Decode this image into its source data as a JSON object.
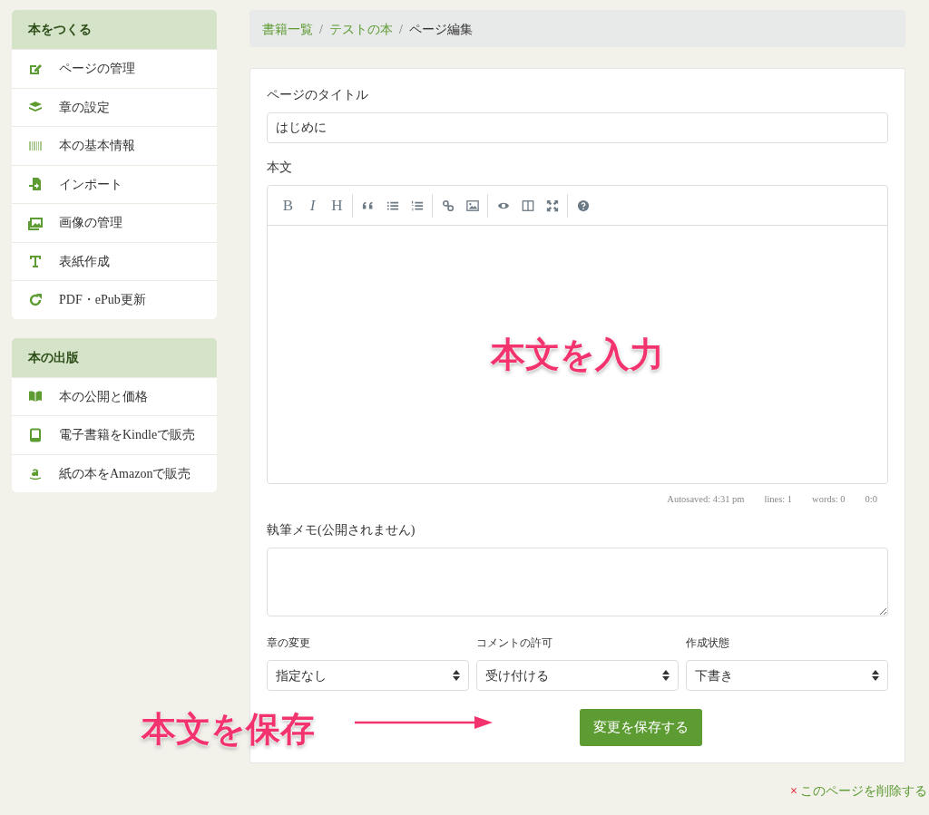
{
  "sidebar": [
    {
      "heading": "本をつくる",
      "items": [
        {
          "label": "ページの管理"
        },
        {
          "label": "章の設定"
        },
        {
          "label": "本の基本情報"
        },
        {
          "label": "インポート"
        },
        {
          "label": "画像の管理"
        },
        {
          "label": "表紙作成"
        },
        {
          "label": "PDF・ePub更新"
        }
      ]
    },
    {
      "heading": "本の出版",
      "items": [
        {
          "label": "本の公開と価格"
        },
        {
          "label": "電子書籍をKindleで販売"
        },
        {
          "label": "紙の本をAmazonで販売"
        }
      ]
    }
  ],
  "breadcrumb": [
    {
      "label": "書籍一覧",
      "link": true
    },
    {
      "separator": "/",
      "label": "テストの本",
      "link": true
    },
    {
      "separator": "/",
      "label": "ページ編集",
      "link": false
    }
  ],
  "form": {
    "title_label": "ページのタイトル",
    "title_value": "はじめに",
    "body_label": "本文",
    "toolbar": [
      [
        {
          "kind": "glyph",
          "text": "B"
        },
        {
          "kind": "glyph",
          "text": "I"
        },
        {
          "kind": "glyph",
          "text": "H"
        }
      ],
      [
        {
          "kind": "icon"
        },
        {
          "kind": "icon"
        },
        {
          "kind": "icon"
        }
      ],
      [
        {
          "kind": "icon"
        },
        {
          "kind": "icon"
        }
      ],
      [
        {
          "kind": "icon"
        },
        {
          "kind": "icon"
        },
        {
          "kind": "icon"
        }
      ],
      [
        {
          "kind": "icon"
        }
      ]
    ],
    "status_bar": [
      "Autosaved: 4:31 pm",
      "lines: 1",
      "words: 0",
      "0:0"
    ],
    "memo_label": "執筆メモ(公開されません)",
    "selects": [
      {
        "label": "章の変更",
        "value": "指定なし"
      },
      {
        "label": "コメントの許可",
        "value": "受け付ける"
      },
      {
        "label": "作成状態",
        "value": "下書き"
      }
    ],
    "save_button": "変更を保存する"
  },
  "delete_link": {
    "icon": "×",
    "label": "このページを削除する"
  },
  "annotations": [
    {
      "kind": "center",
      "text": "本文を入力"
    },
    {
      "kind": "arrow",
      "text": "本文を保存"
    }
  ]
}
